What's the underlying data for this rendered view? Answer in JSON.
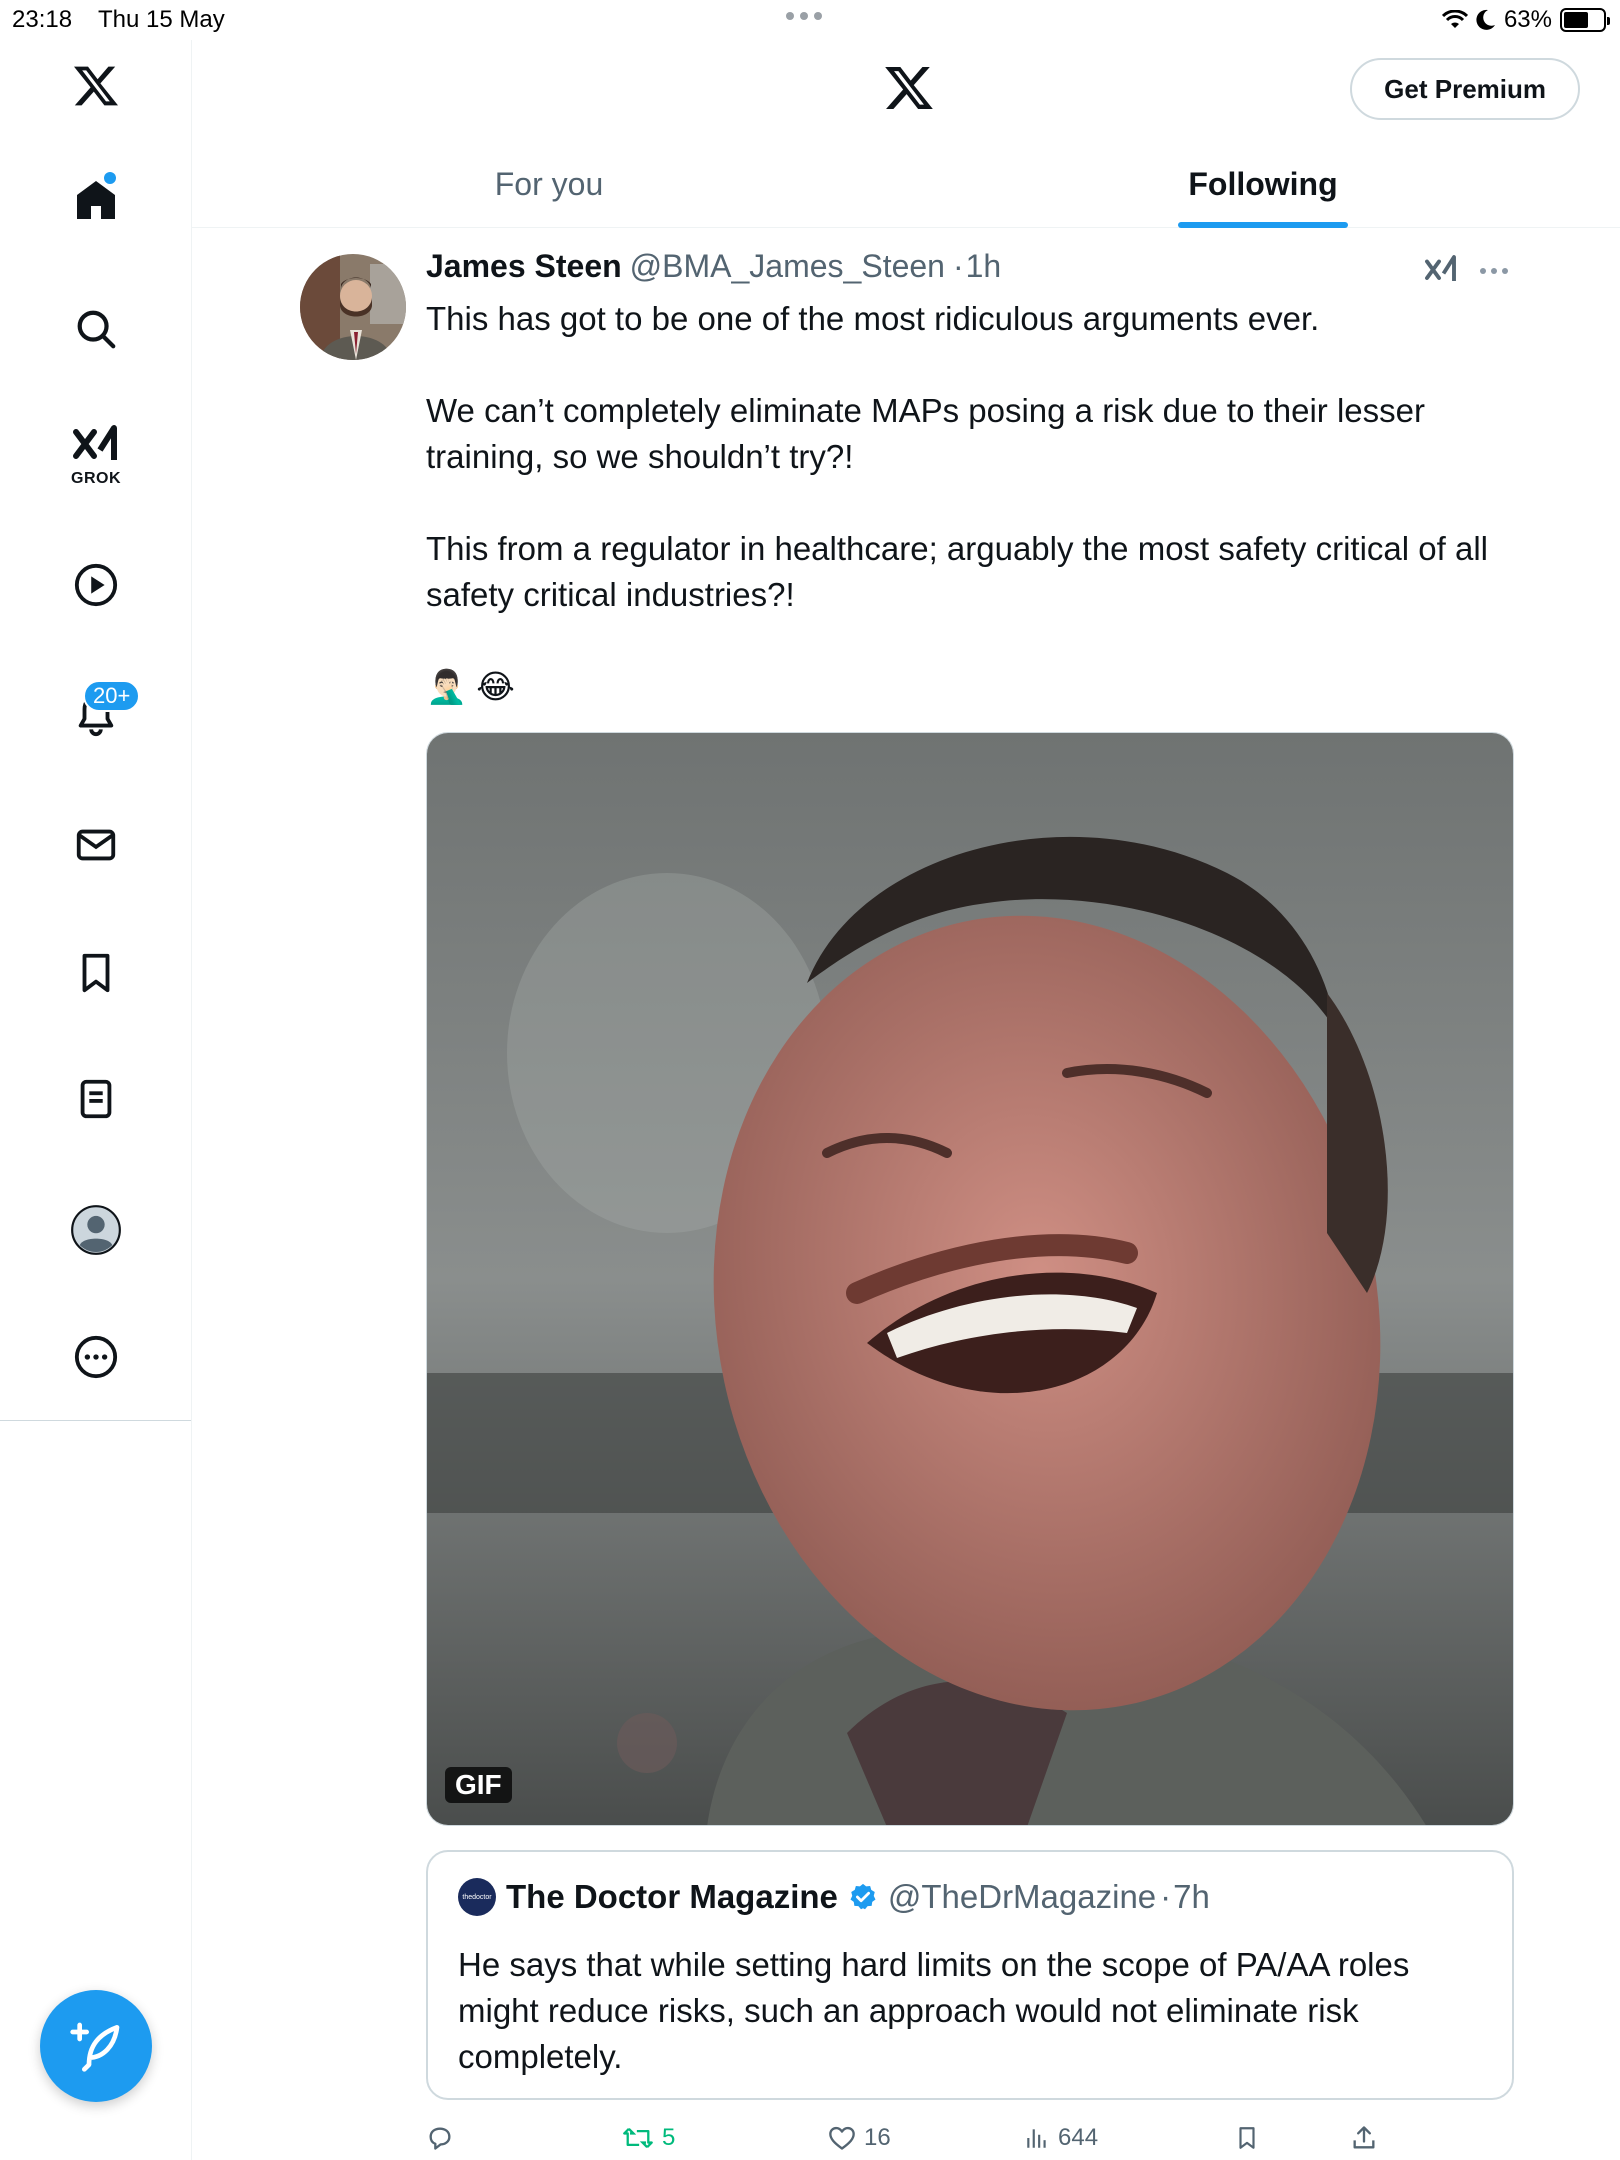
{
  "status_bar": {
    "time": "23:18",
    "date": "Thu 15 May",
    "battery": "63%",
    "battery_level": 0.63
  },
  "sidebar": {
    "items": [
      {
        "name": "home",
        "icon": "home-icon"
      },
      {
        "name": "explore",
        "icon": "search-icon"
      },
      {
        "name": "grok",
        "icon": "grok-icon",
        "label": "GROK"
      },
      {
        "name": "video",
        "icon": "play-icon"
      },
      {
        "name": "notifications",
        "icon": "bell-icon",
        "badge": "20+"
      },
      {
        "name": "messages",
        "icon": "mail-icon"
      },
      {
        "name": "bookmarks",
        "icon": "bookmark-icon"
      },
      {
        "name": "lists",
        "icon": "list-icon"
      },
      {
        "name": "profile",
        "icon": "profile-icon"
      },
      {
        "name": "more",
        "icon": "more-icon"
      }
    ],
    "compose_icon": "compose-icon"
  },
  "header": {
    "premium_label": "Get Premium",
    "tabs": [
      {
        "label": "For you",
        "active": false
      },
      {
        "label": "Following",
        "active": true
      }
    ]
  },
  "tweet": {
    "author_name": "James Steen",
    "author_handle": "@BMA_James_Steen",
    "separator": "·",
    "time": "1h",
    "body": [
      "This has got to be one of the most ridiculous arguments ever.",
      "",
      "We can’t completely eliminate MAPs posing a risk due to their lesser training, so we shouldn’t try?!",
      "",
      "This from a regulator in healthcare; arguably the most safety critical of all safety critical industries?!",
      "",
      "🤦🏻‍♂️ 😂"
    ],
    "media_badge": "GIF",
    "quote": {
      "author_name": "The Doctor Magazine",
      "author_handle": "@TheDrMagazine",
      "separator": "·",
      "time": "7h",
      "logo_text": "thedoctor",
      "body": "He says that while setting hard limits on the scope of PA/AA roles might reduce risks, such an approach would not eliminate risk completely."
    },
    "actions": {
      "replies": "",
      "retweets": "5",
      "likes": "16",
      "views": "644"
    }
  },
  "colors": {
    "accent": "#1d9bf0",
    "retweet": "#00ba7c",
    "muted": "#536471",
    "border": "#cfd9de"
  }
}
